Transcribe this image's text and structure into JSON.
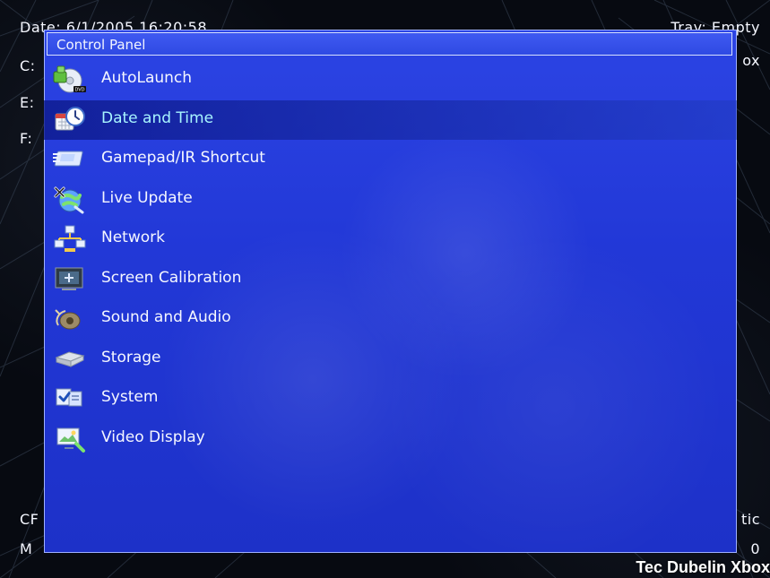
{
  "background": {
    "top_left_date": "Date: 6/1/2005 16:20:58",
    "top_right_tray": "Tray: Empty",
    "left_labels": [
      "C:",
      "E:",
      "F:"
    ],
    "right_label_box": "ox",
    "bottom_left_label": "CF",
    "bottom_right_label": "tic",
    "bottom_left_m": "M",
    "bottom_right_zero": "0",
    "brand_text": "Tec Dubelin Xbox"
  },
  "panel": {
    "title": "Control Panel",
    "selected_index": 1,
    "items": [
      {
        "label": "AutoLaunch",
        "icon": "dvd-icon"
      },
      {
        "label": "Date and Time",
        "icon": "clock-calendar-icon"
      },
      {
        "label": "Gamepad/IR Shortcut",
        "icon": "gamepad-shortcut-icon"
      },
      {
        "label": "Live Update",
        "icon": "live-update-icon"
      },
      {
        "label": "Network",
        "icon": "network-icon"
      },
      {
        "label": "Screen Calibration",
        "icon": "screen-calibration-icon"
      },
      {
        "label": "Sound and Audio",
        "icon": "sound-audio-icon"
      },
      {
        "label": "Storage",
        "icon": "storage-icon"
      },
      {
        "label": "System",
        "icon": "system-icon"
      },
      {
        "label": "Video Display",
        "icon": "video-display-icon"
      }
    ]
  },
  "colors": {
    "panel_blue": "#2238d7",
    "selected_text": "#a8f5ff",
    "title_text": "#f2f5ff"
  }
}
